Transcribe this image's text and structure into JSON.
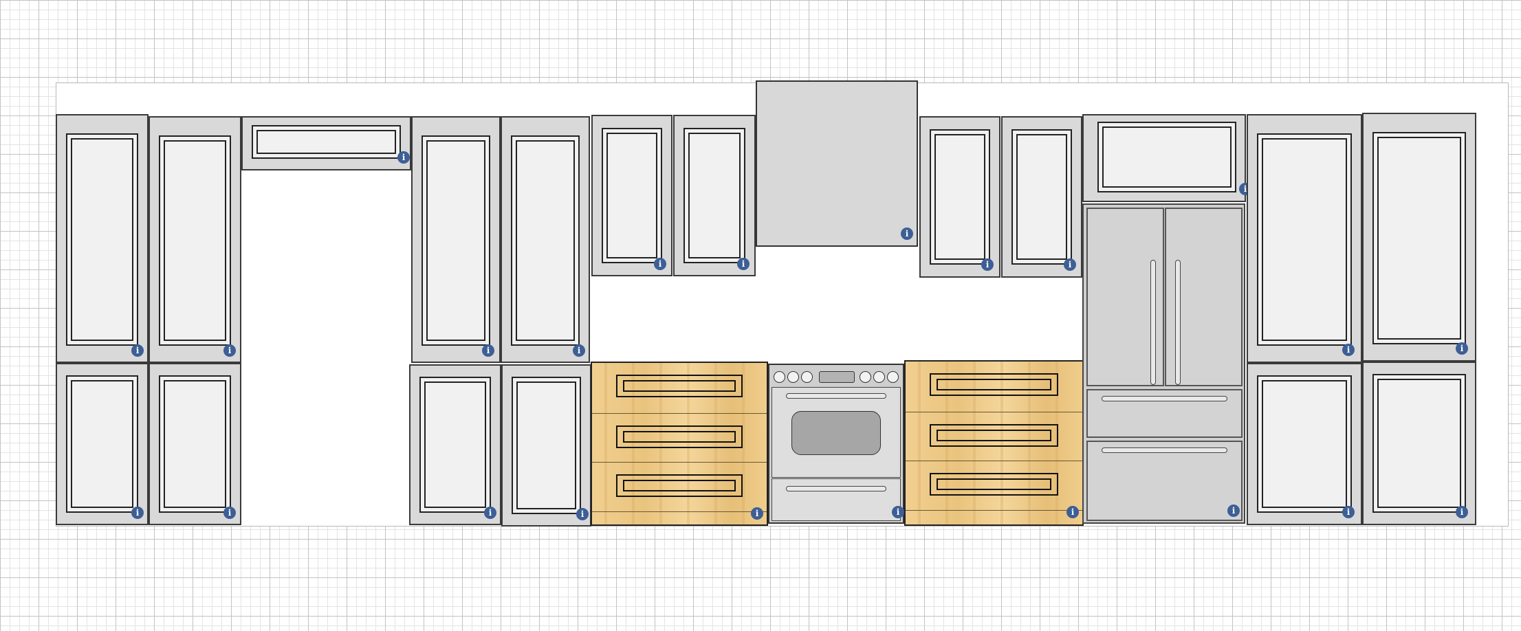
{
  "canvas": {
    "grid": "on",
    "view": "kitchen wall elevation"
  },
  "colors": {
    "info_badge": "#3d5f96",
    "cabinet": "#d9d9d9",
    "door_panel": "#f1f1f1",
    "wood": "#eccb8a"
  },
  "icons": {
    "info": "i"
  },
  "appliances": {
    "range": {
      "burner_knobs": 6
    },
    "refrigerator": {
      "type": "french-door"
    }
  }
}
